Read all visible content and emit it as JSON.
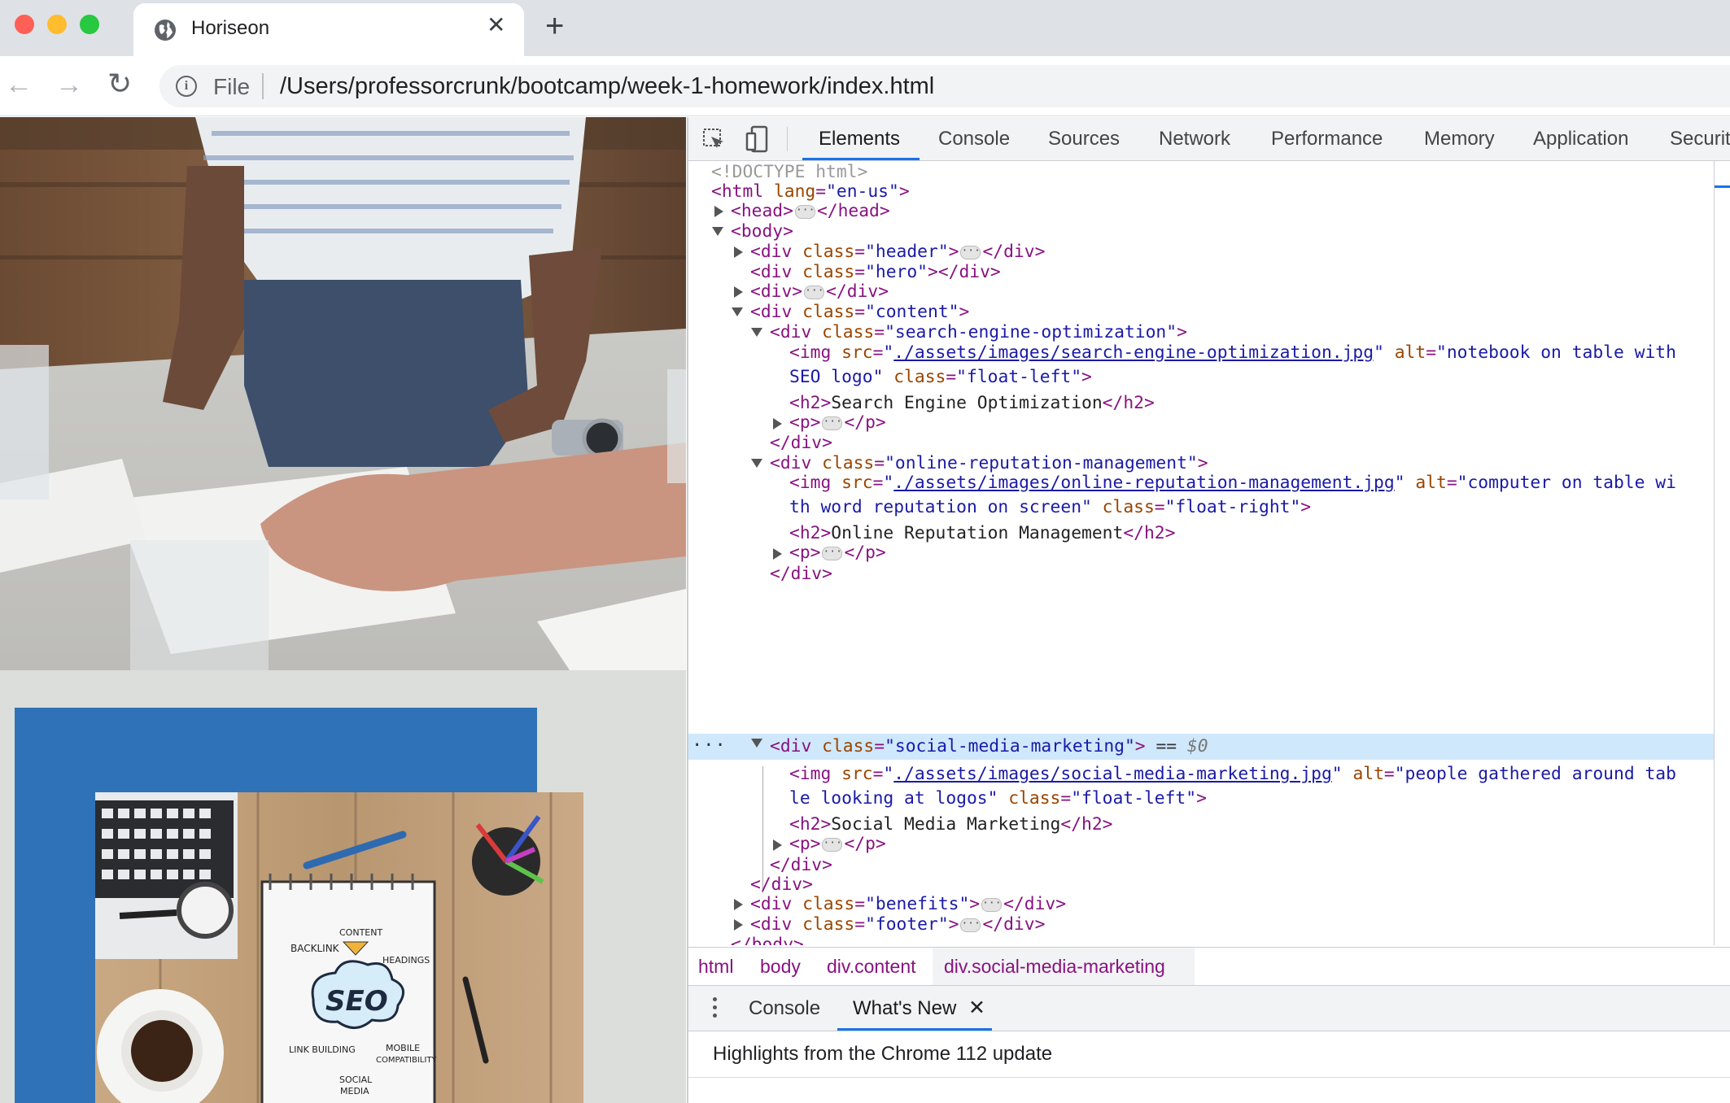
{
  "browser": {
    "tab_title": "Horiseon",
    "tab_close_glyph": "✕",
    "new_tab_glyph": "+",
    "back_glyph": "←",
    "forward_glyph": "→",
    "reload_glyph": "↻",
    "file_label": "File",
    "url": "/Users/professorcrunk/bootcamp/week-1-homework/index.html"
  },
  "devtools": {
    "tabs": [
      "Elements",
      "Console",
      "Sources",
      "Network",
      "Performance",
      "Memory",
      "Application",
      "Securit"
    ],
    "active_tab": "Elements",
    "tree": {
      "doctype": "<!DOCTYPE html>",
      "html_open": "<html",
      "lang_attr": "lang",
      "lang_val": "\"en-us\"",
      "head": "<head>",
      "head_close": "</head>",
      "body": "<body>",
      "div_open": "<div",
      "div_close": "</div>",
      "class_attr": "class",
      "header_val": "\"header\"",
      "hero_val": "\"hero\"",
      "content_val": "\"content\"",
      "seo_val": "\"search-engine-optimization\"",
      "orm_val": "\"online-reputation-management\"",
      "smm_val": "\"social-media-marketing\"",
      "benefits_val": "\"benefits\"",
      "footer_val": "\"footer\"",
      "img_open": "<img",
      "src_attr": "src",
      "alt_attr": "alt",
      "seo_src": "./assets/images/search-engine-optimization.jpg",
      "seo_alt_1": "\"notebook on table with",
      "seo_alt_2": "SEO logo\"",
      "float_left": "\"float-left\"",
      "float_right": "\"float-right\"",
      "seo_h2": "Search Engine Optimization",
      "orm_src": "./assets/images/online-reputation-management.jpg",
      "orm_alt_1": "\"computer on table wi",
      "orm_alt_2": "th word reputation on screen\"",
      "orm_h2": "Online Reputation Management",
      "smm_src": "./assets/images/social-media-marketing.jpg",
      "smm_alt_1": "\"people gathered around tab",
      "smm_alt_2": "le looking at logos\"",
      "smm_h2": "Social Media Marketing",
      "h2_open": "<h2>",
      "h2_close": "</h2>",
      "p_open": "<p>",
      "p_close": "</p>",
      "eq_sel": "== ",
      "dollar_sel": "$0",
      "body_close": "</body>",
      "ellipsis": "···",
      "sel_dots": "···"
    },
    "breadcrumbs": [
      "html",
      "body",
      "div.content",
      "div.social-media-marketing"
    ],
    "drawer_tabs": [
      "Console",
      "What's New"
    ],
    "drawer_close": "✕",
    "highlights": "Highlights from the Chrome 112 update"
  },
  "page_image": {
    "seo_words": {
      "content": "CONTENT",
      "backlink": "BACKLINK",
      "headings": "HEADINGS",
      "seo": "SEO",
      "link_building": "LINK BUILDING",
      "mobile": "MOBILE",
      "compat": "COMPATIBILITY",
      "social": "SOCIAL",
      "media": "MEDIA"
    }
  },
  "colors": {
    "accent": "#1a73e8",
    "blue_box": "#2f72b8",
    "selection": "#cfe8fc"
  }
}
